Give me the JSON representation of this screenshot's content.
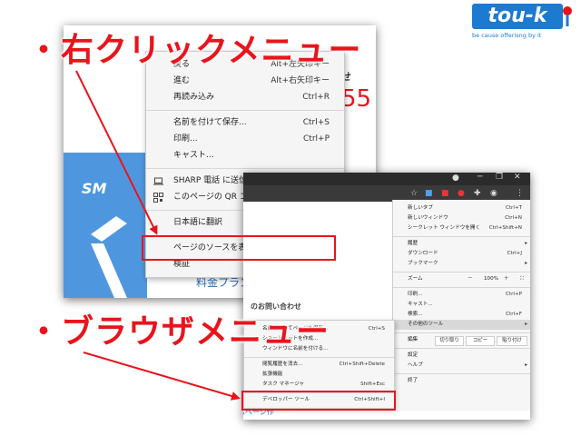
{
  "annotations": {
    "right_click_menu": "・右クリックメニュー",
    "browser_menu": "・ブラウザメニュー"
  },
  "logo": {
    "word": "tou-k",
    "tagline": "be cause offerisng by it"
  },
  "page1": {
    "logo_text": "SM",
    "heading_fragment": "せ",
    "price_fragment": "55",
    "link": "料金プラン"
  },
  "context_menu": {
    "items": [
      {
        "label": "戻る",
        "key": "Alt+左矢印キー"
      },
      {
        "label": "進む",
        "key": "Alt+右矢印キー"
      },
      {
        "label": "再読み込み",
        "key": "Ctrl+R"
      },
      {
        "label": "名前を付けて保存...",
        "key": "Ctrl+S"
      },
      {
        "label": "印刷...",
        "key": "Ctrl+P"
      },
      {
        "label": "キャスト...",
        "key": ""
      },
      {
        "label": "SHARP 電話 に送信",
        "key": ""
      },
      {
        "label": "このページの QR コードを作成",
        "key": ""
      },
      {
        "label": "日本語に翻訳",
        "key": ""
      },
      {
        "label": "ページのソースを表示",
        "key": "Ctrl+U"
      },
      {
        "label": "検証",
        "key": "Ctrl+Shift+I"
      }
    ]
  },
  "page2": {
    "heading": "のお問い合わせ",
    "link1": "ブ",
    "link2": "ムページ作"
  },
  "browser_menu": {
    "items": [
      {
        "label": "新しいタブ",
        "key": "Ctrl+T"
      },
      {
        "label": "新しいウィンドウ",
        "key": "Ctrl+N"
      },
      {
        "label": "シークレット ウィンドウを開く",
        "key": "Ctrl+Shift+N"
      },
      {
        "label": "履歴",
        "key": ""
      },
      {
        "label": "ダウンロード",
        "key": "Ctrl+J"
      },
      {
        "label": "ブックマーク",
        "key": ""
      },
      {
        "label": "印刷...",
        "key": "Ctrl+P"
      },
      {
        "label": "キャスト...",
        "key": ""
      },
      {
        "label": "検索...",
        "key": "Ctrl+F"
      },
      {
        "label": "その他のツール",
        "key": ""
      },
      {
        "label": "設定",
        "key": ""
      },
      {
        "label": "ヘルプ",
        "key": ""
      },
      {
        "label": "終了",
        "key": ""
      }
    ],
    "zoom": {
      "label": "ズーム",
      "minus": "－",
      "value": "100%",
      "plus": "＋"
    },
    "edit": {
      "label": "編集",
      "cut": "切り取り",
      "copy": "コピー",
      "paste": "貼り付け"
    }
  },
  "sub_menu": {
    "items": [
      {
        "label": "名前を付けてページを保存...",
        "key": "Ctrl+S"
      },
      {
        "label": "ショートカットを作成...",
        "key": ""
      },
      {
        "label": "ウィンドウに名前を付ける...",
        "key": ""
      },
      {
        "label": "閲覧履歴を消去...",
        "key": "Ctrl+Shift+Delete"
      },
      {
        "label": "拡張機能",
        "key": ""
      },
      {
        "label": "タスク マネージャ",
        "key": "Shift+Esc"
      },
      {
        "label": "デベロッパー ツール",
        "key": "Ctrl+Shift+I"
      }
    ]
  },
  "colors": {
    "annotation_red": "#e8141c",
    "logo_blue": "#1c7ad0"
  }
}
